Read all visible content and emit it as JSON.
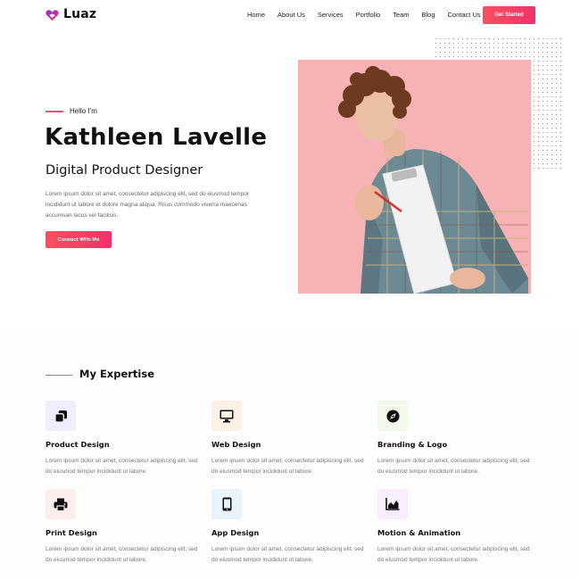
{
  "brand": {
    "name": "Luaz",
    "accent": "#f2316b",
    "accent_start": "#f5515f"
  },
  "nav": {
    "items": [
      "Home",
      "About Us",
      "Services",
      "Portfolio",
      "Team",
      "Blog",
      "Contact Us"
    ],
    "cta": "Get Started"
  },
  "hero": {
    "greeting": "Hello I'm",
    "name": "Kathleen Lavelle",
    "role": "Digital Product Designer",
    "description": "Lorem ipsum dolor sit amet, consectetur adipiscing elit, sed do eiusmod tempor incididunt ut labore et dolore magna aliqua. Risus commodo viverra maecenas accumsan lacus vel facilisis.",
    "cta": "Connect With Me",
    "image_bg": "#f6b2b4"
  },
  "expertise": {
    "title": "My Expertise",
    "items": [
      {
        "title": "Product Design",
        "icon": "layers-icon",
        "icon_bg": "#efeefe",
        "icon_color": "#111",
        "desc": "Lorem ipsum dolor sit amet, consectetur adipiscing elit, sed do eiusmod tempor incididunt ut labore."
      },
      {
        "title": "Web Design",
        "icon": "monitor-icon",
        "icon_bg": "#fdf1e6",
        "icon_color": "#111",
        "desc": "Lorem ipsum dolor sit amet, consectetur adipiscing elit, sed do eiusmod tempor incididunt ut labore."
      },
      {
        "title": "Branding & Logo",
        "icon": "compass-icon",
        "icon_bg": "#f3f8ec",
        "icon_color": "#111",
        "desc": "Lorem ipsum dolor sit amet, consectetur adipiscing elit, sed do eiusmod tempor incididunt ut labore."
      },
      {
        "title": "Print Design",
        "icon": "printer-icon",
        "icon_bg": "#fdeeee",
        "icon_color": "#111",
        "desc": "Lorem ipsum dolor sit amet, consectetur adipiscing elit, sed do eiusmod tempor incididunt ut labore."
      },
      {
        "title": "App Design",
        "icon": "mobile-icon",
        "icon_bg": "#e9f3fd",
        "icon_color": "#111",
        "desc": "Lorem ipsum dolor sit amet, consectetur adipiscing elit, sed do eiusmod tempor incididunt ut labore."
      },
      {
        "title": "Motion & Animation",
        "icon": "chart-icon",
        "icon_bg": "#f7effd",
        "icon_color": "#111",
        "desc": "Lorem ipsum dolor sit amet, consectetur adipiscing elit, sed do eiusmod tempor incididunt ut labore."
      }
    ]
  }
}
